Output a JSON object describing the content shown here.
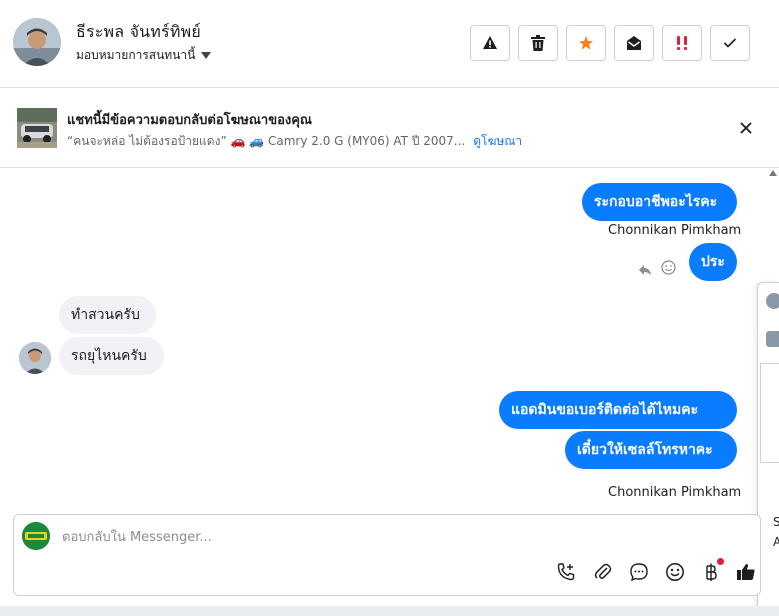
{
  "header": {
    "contact_name": "ธีระพล จันทร์ทิพย์",
    "assign_label": "มอบหมายการสนทนานี้",
    "toolbar": [
      {
        "icon": "warning-icon",
        "color": "#1c1e21"
      },
      {
        "icon": "trash-icon",
        "color": "#1c1e21"
      },
      {
        "icon": "star-icon",
        "color": "#f5811f"
      },
      {
        "icon": "open-envelope-icon",
        "color": "#1c1e21"
      },
      {
        "icon": "double-exclamation-icon",
        "color": "#e41e3f"
      },
      {
        "icon": "check-icon",
        "color": "#1c1e21"
      }
    ]
  },
  "ad_banner": {
    "title": "แชทนี้มีข้อความตอบกลับต่อโฆษณาของคุณ",
    "subtitle": "“คนจะหล่อ ไม่ต้องรอป้ายแดง” 🚗 🚙 Camry 2.0 G (MY06) AT ปี 2007...",
    "link": "ดูโฆษณา"
  },
  "messages": {
    "out_1": "ระกอบอาชีพอะไรคะ",
    "sender_1": "Chonnikan Pimkham",
    "out_2": "ประ",
    "in_1": "ทำสวนครับ",
    "in_2": "รถยุไหนครับ",
    "out_3": "แอดมินขอเบอร์ติดต่อได้ไหมคะ",
    "out_4": "เดี๋ยวให้เซลล์โทรหาคะ",
    "sender_2": "Chonnikan Pimkham"
  },
  "side_panel": {
    "text_1": "S",
    "text_2": "A"
  },
  "composer": {
    "placeholder": "ตอบกลับใน Messenger..."
  },
  "colors": {
    "outgoing_bubble": "#0a7cff",
    "incoming_bubble": "#f0f2f5",
    "link": "#1877f2"
  }
}
